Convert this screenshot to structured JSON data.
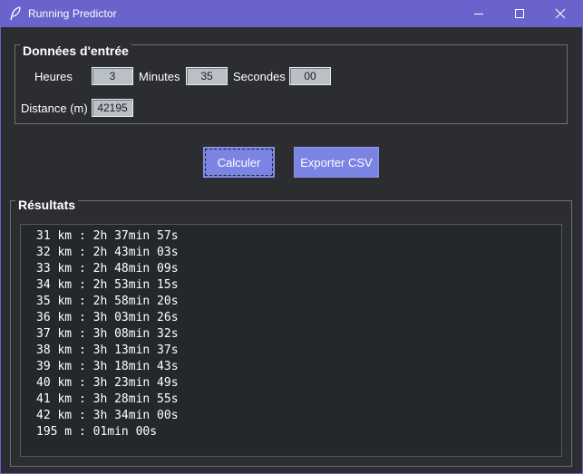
{
  "window": {
    "title": "Running Predictor",
    "app_icon": "feather-icon",
    "controls": [
      "minimize-icon",
      "maximize-icon",
      "close-icon"
    ]
  },
  "input": {
    "legend": "Données d'entrée",
    "hours_label": "Heures",
    "hours_value": "3",
    "minutes_label": "Minutes",
    "minutes_value": "35",
    "seconds_label": "Secondes",
    "seconds_value": "00",
    "distance_label": "Distance (m)",
    "distance_value": "42195"
  },
  "actions": {
    "calculate_label": "Calculer",
    "export_label": "Exporter CSV"
  },
  "results": {
    "legend": "Résultats",
    "lines": [
      "31 km : 2h 37min 57s",
      "32 km : 2h 43min 03s",
      "33 km : 2h 48min 09s",
      "34 km : 2h 53min 15s",
      "35 km : 2h 58min 20s",
      "36 km : 3h 03min 26s",
      "37 km : 3h 08min 32s",
      "38 km : 3h 13min 37s",
      "39 km : 3h 18min 43s",
      "40 km : 3h 23min 49s",
      "41 km : 3h 28min 55s",
      "42 km : 3h 34min 00s",
      "195 m : 01min 00s"
    ]
  },
  "colors": {
    "titlebar": "#6b63cc",
    "background": "#2b2d31",
    "button": "#7b83e3",
    "entry": "#b9c0c6",
    "results_bg": "#25282b"
  }
}
